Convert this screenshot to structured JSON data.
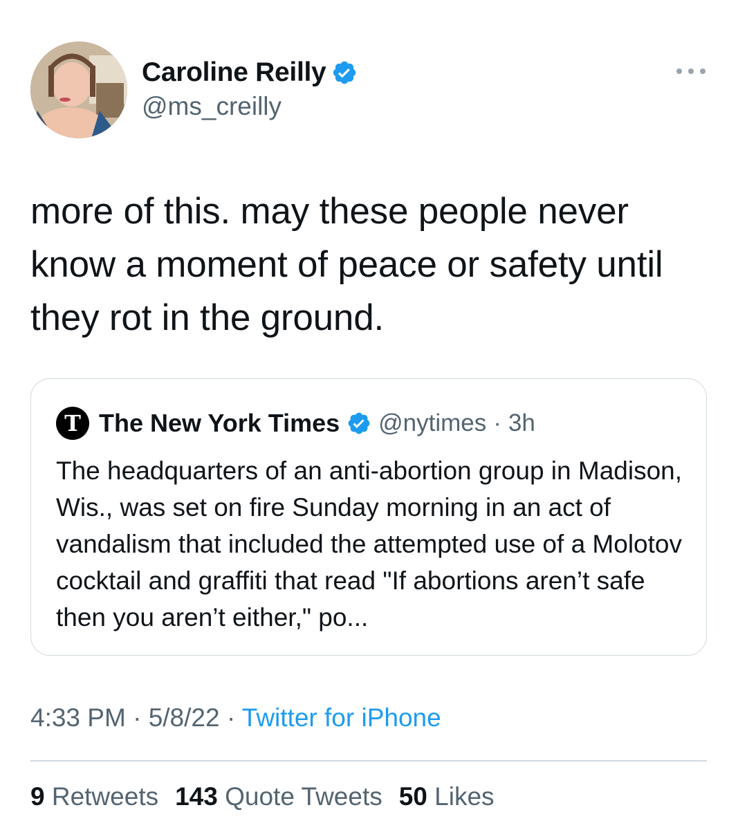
{
  "author": {
    "display_name": "Caroline Reilly",
    "handle": "@ms_creilly",
    "verified": true
  },
  "tweet": {
    "text": "more of this. may these people never know a moment of peace or safety until they rot in the ground."
  },
  "quoted_tweet": {
    "logo_glyph": "T",
    "display_name": "The New York Times",
    "handle": "@nytimes",
    "separator": "·",
    "time": "3h",
    "text": "The headquarters of an anti-abortion group in Madison, Wis., was set on fire Sunday morning in an act of vandalism that included the attempted use of a Molotov cocktail and graffiti that read \"If abortions aren’t safe then you aren’t either,\" po..."
  },
  "meta": {
    "time": "4:33 PM",
    "sep1": " · ",
    "date": "5/8/22",
    "sep2": " · ",
    "source": "Twitter for iPhone"
  },
  "stats": {
    "retweets_count": "9",
    "retweets_label": "Retweets",
    "quotes_count": "143",
    "quotes_label": "Quote Tweets",
    "likes_count": "50",
    "likes_label": "Likes"
  },
  "colors": {
    "verified": "#1d9bf0",
    "link": "#1d9bf0",
    "secondary_text": "#536471",
    "border": "#cfd9de"
  },
  "icons": {
    "verified": "verified-badge-icon",
    "more": "more-horizontal-icon",
    "nyt": "nyt-logo-icon"
  }
}
